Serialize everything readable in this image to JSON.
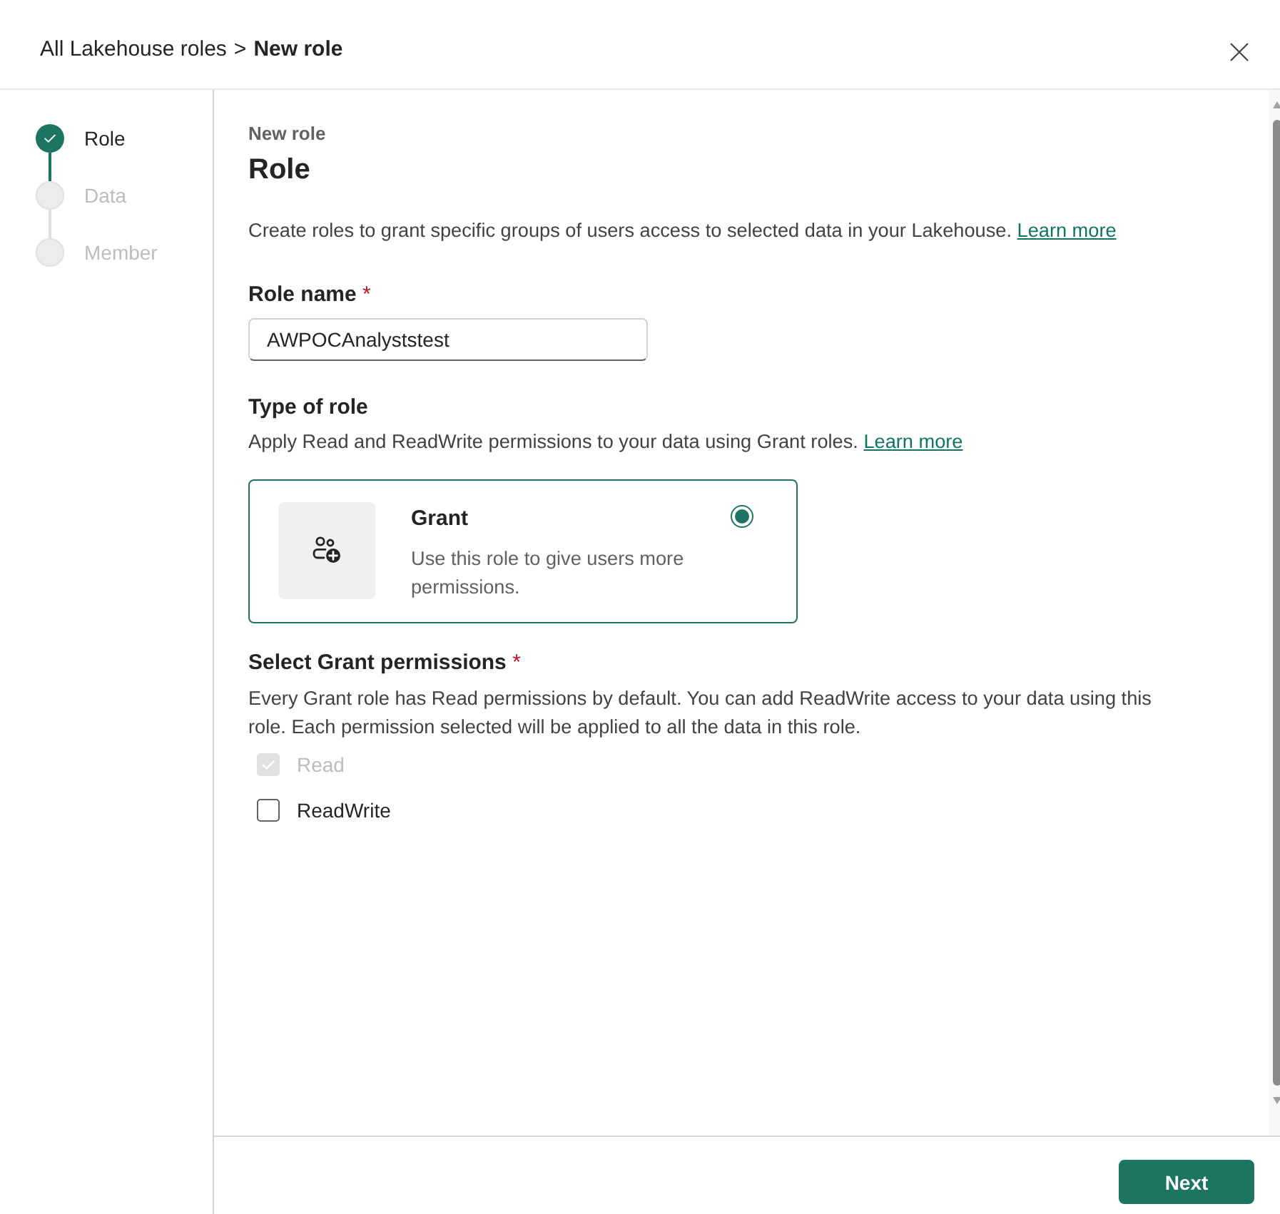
{
  "breadcrumb": {
    "parent": "All Lakehouse roles",
    "separator": ">",
    "current": "New role"
  },
  "steps": [
    {
      "label": "Role",
      "completed": true
    },
    {
      "label": "Data",
      "completed": false
    },
    {
      "label": "Member",
      "completed": false
    }
  ],
  "intro": {
    "caption": "New role",
    "title": "Role",
    "description": "Create roles to grant specific groups of users access to selected data in your Lakehouse.",
    "link": "Learn more"
  },
  "role_name": {
    "label": "Role name",
    "required_mark": "*",
    "value": "AWPOCAnalyststest"
  },
  "role_type": {
    "heading": "Type of role",
    "description": "Apply Read and ReadWrite permissions to your data using Grant roles.",
    "link": "Learn more",
    "options": [
      {
        "title": "Grant",
        "description": "Use this role to give users more permissions.",
        "selected": true
      }
    ]
  },
  "permissions": {
    "heading": "Select Grant permissions",
    "required_mark": "*",
    "description": "Every Grant role has Read permissions by default. You can add ReadWrite access to your data using this role. Each permission selected will be applied to all the data in this role.",
    "items": [
      {
        "label": "Read",
        "checked": true,
        "disabled": true
      },
      {
        "label": "ReadWrite",
        "checked": false,
        "disabled": false
      }
    ]
  },
  "footer": {
    "buttons": [
      {
        "label": "Next",
        "kind": "primary"
      }
    ]
  }
}
